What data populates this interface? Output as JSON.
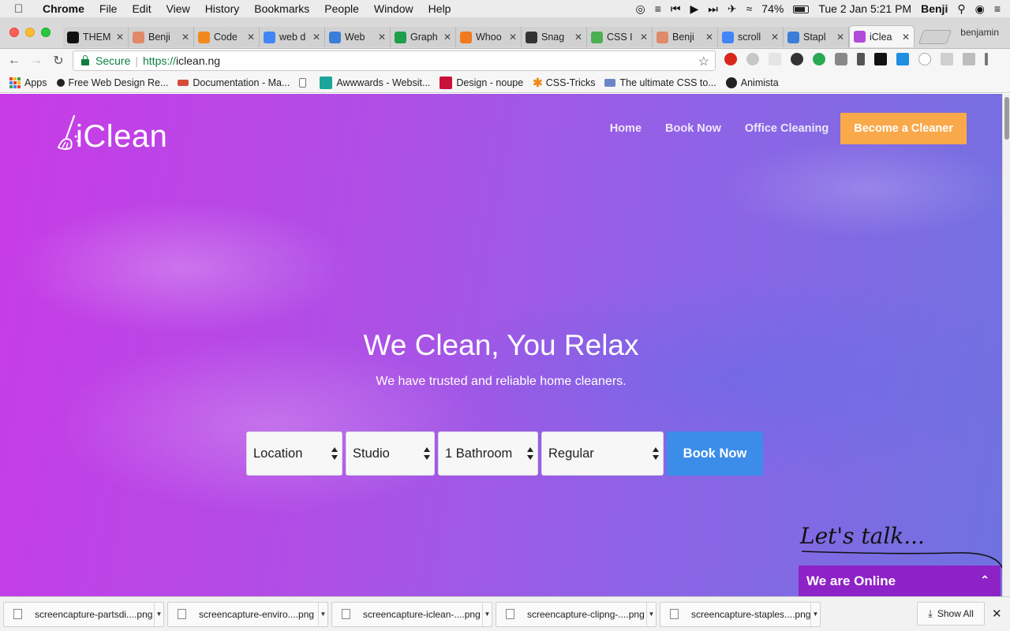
{
  "menubar": {
    "app": "Chrome",
    "items": [
      "File",
      "Edit",
      "View",
      "History",
      "Bookmarks",
      "People",
      "Window",
      "Help"
    ],
    "battery": "74%",
    "clock": "Tue 2 Jan  5:21 PM",
    "user": "Benji"
  },
  "tabs": [
    {
      "label": "THEM",
      "icon": "tl-icon",
      "color": "#111111"
    },
    {
      "label": "Benji",
      "icon": "ice-cream-icon",
      "color": "#e08a6a"
    },
    {
      "label": "Code",
      "icon": "asterisk-icon",
      "color": "#f08a1e"
    },
    {
      "label": "web d",
      "icon": "google-icon",
      "color": "#4285f4"
    },
    {
      "label": "Web",
      "icon": "info-icon",
      "color": "#3b7dd8"
    },
    {
      "label": "Graph",
      "icon": "sheets-icon",
      "color": "#1e9e4a"
    },
    {
      "label": "Whoo",
      "icon": "pin-icon",
      "color": "#f07a1e"
    },
    {
      "label": "Snag",
      "icon": "snagit-icon",
      "color": "#333333"
    },
    {
      "label": "CSS I",
      "icon": "w3-icon",
      "color": "#4caf50"
    },
    {
      "label": "Benji",
      "icon": "ice-cream-icon",
      "color": "#e08a6a"
    },
    {
      "label": "scroll",
      "icon": "google-icon",
      "color": "#4285f4"
    },
    {
      "label": "Stapl",
      "icon": "staple-icon",
      "color": "#3b7dd8"
    },
    {
      "label": "iClea",
      "icon": "iclean-icon",
      "color": "#b44bd8"
    }
  ],
  "profile_name": "benjamin",
  "omnibox": {
    "secure_label": "Secure",
    "url_proto": "https://",
    "url_host": "iclean.ng"
  },
  "bookmarks": [
    {
      "label": "Apps",
      "icon": "apps-grid-icon"
    },
    {
      "label": "Free Web Design Re...",
      "icon": "bookmark-icon"
    },
    {
      "label": "Documentation - Ma...",
      "icon": "bookmark-icon"
    },
    {
      "label": "",
      "icon": "page-icon"
    },
    {
      "label": "Awwwards - Websit...",
      "icon": "awwwards-icon"
    },
    {
      "label": "Design - noupe",
      "icon": "noupe-icon"
    },
    {
      "label": "CSS-Tricks",
      "icon": "asterisk-icon"
    },
    {
      "label": "The ultimate CSS to...",
      "icon": "bookmark-icon"
    },
    {
      "label": "Animista",
      "icon": "animista-icon"
    }
  ],
  "site": {
    "logo": "iClean",
    "nav": [
      "Home",
      "Book Now",
      "Office Cleaning"
    ],
    "cta": "Become a Cleaner",
    "hero_title": "We Clean, You Relax",
    "hero_subtitle": "We have trusted and reliable home cleaners.",
    "booking": {
      "location": "Location",
      "apartment": "Studio",
      "bathrooms": "1 Bathroom",
      "frequency": "Regular",
      "submit": "Book Now"
    },
    "lets_talk": "Let's talk...",
    "chat_label": "We are Online"
  },
  "downloads": [
    "screencapture-partsdi....png",
    "screencapture-enviro....png",
    "screencapture-iclean-....png",
    "screencapture-clipng-....png",
    "screencapture-staples....png"
  ],
  "show_all": "Show All",
  "colors": {
    "accent_orange": "#f9a94a",
    "button_blue": "#3b8de9",
    "chat_purple": "#8d22c7"
  }
}
